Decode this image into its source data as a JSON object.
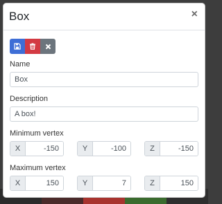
{
  "modal": {
    "title": "Box",
    "close_symbol": "×"
  },
  "toolbar": {
    "buttons": [
      {
        "icon": "save-icon",
        "color": "#3e6ed6"
      },
      {
        "icon": "trash-icon",
        "color": "#d33a43"
      },
      {
        "icon": "close-icon",
        "color": "#6c757d"
      }
    ]
  },
  "fields": {
    "name": {
      "label": "Name",
      "value": "Box"
    },
    "description": {
      "label": "Description",
      "value": "A box!"
    }
  },
  "min_vertex": {
    "label": "Minimum vertex",
    "x": {
      "axis": "X",
      "value": "-150"
    },
    "y": {
      "axis": "Y",
      "value": "-100"
    },
    "z": {
      "axis": "Z",
      "value": "-150"
    }
  },
  "max_vertex": {
    "label": "Maximum vertex",
    "x": {
      "axis": "X",
      "value": "150"
    },
    "y": {
      "axis": "Y",
      "value": "7"
    },
    "z": {
      "axis": "Z",
      "value": "150"
    }
  },
  "backdrop_colors": [
    "#2b2b2b",
    "#4a2a2a",
    "#a8332e",
    "#3a6b2e",
    "#2e2e2e"
  ]
}
